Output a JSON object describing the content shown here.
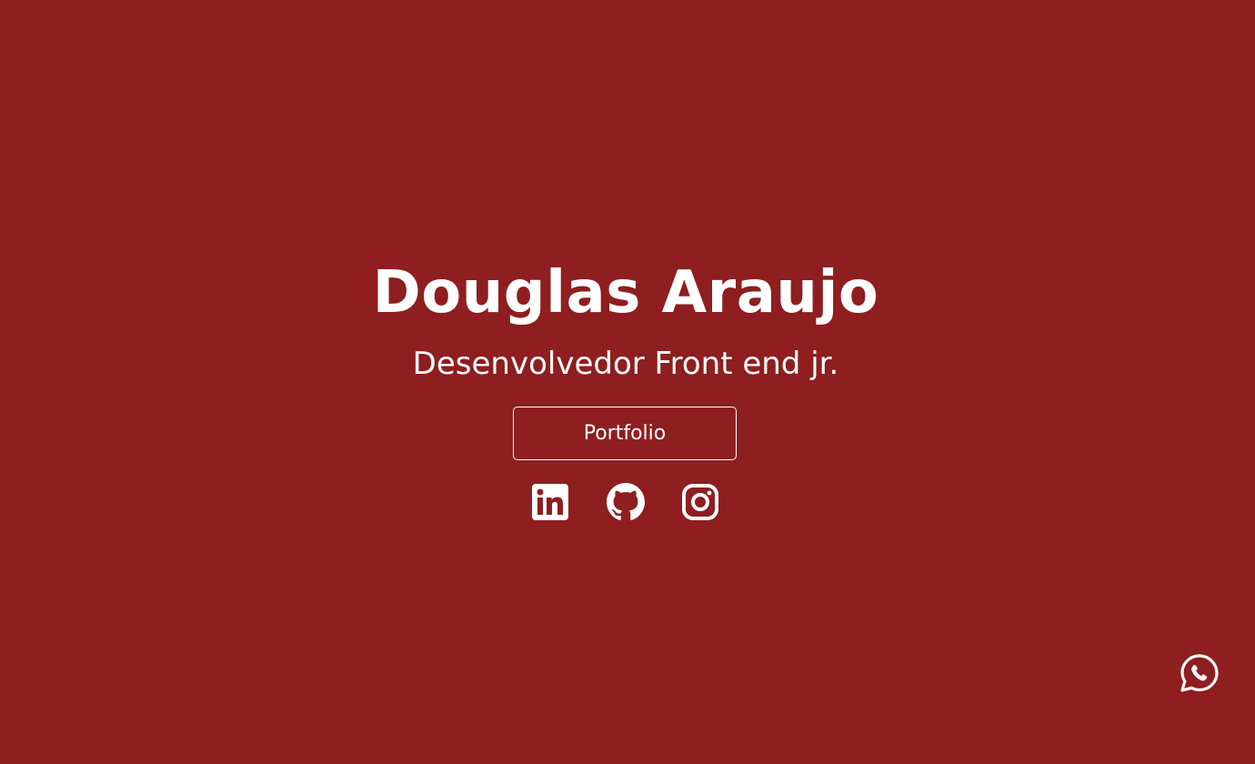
{
  "hero": {
    "name": "Douglas Araujo",
    "role": "Desenvolvedor Front end jr.",
    "portfolio_label": "Portfolio"
  },
  "social": [
    {
      "icon": "linkedin-icon"
    },
    {
      "icon": "github-icon"
    },
    {
      "icon": "instagram-icon"
    }
  ],
  "floating": {
    "icon": "whatsapp-icon"
  },
  "colors": {
    "background": "#8e1e1f",
    "foreground": "#ffffff"
  }
}
